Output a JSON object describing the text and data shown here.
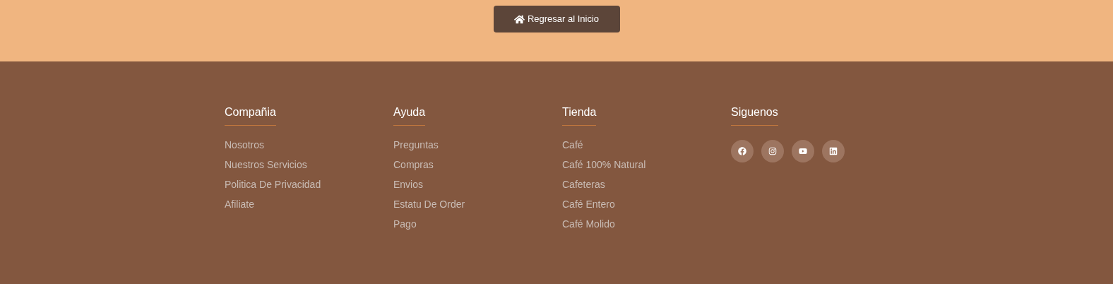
{
  "home_button": {
    "label": "Regresar al Inicio"
  },
  "footer_columns": [
    {
      "title": "Compañia",
      "links": [
        "Nosotros",
        "Nuestros Servicios",
        "Politica De Privacidad",
        "Afiliate"
      ]
    },
    {
      "title": "Ayuda",
      "links": [
        "Preguntas",
        "Compras",
        "Envios",
        "Estatu De Order",
        "Pago"
      ]
    },
    {
      "title": "Tienda",
      "links": [
        "Café",
        "Café 100% Natural",
        "Cafeteras",
        "Café Entero",
        "Café Molido"
      ]
    },
    {
      "title": "Siguenos",
      "social": [
        {
          "kind": "facebook"
        },
        {
          "kind": "instagram"
        },
        {
          "kind": "youtube"
        },
        {
          "kind": "linkedin"
        }
      ]
    }
  ]
}
